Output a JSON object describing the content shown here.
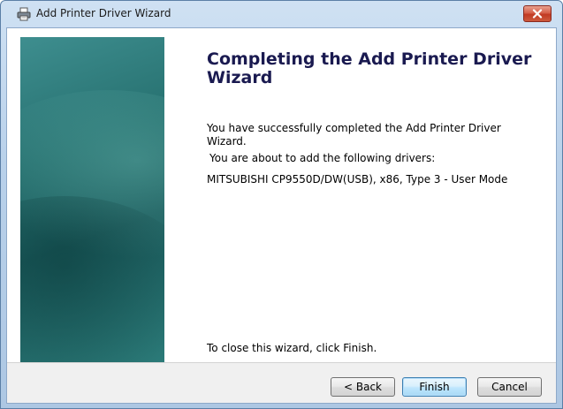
{
  "window": {
    "title": "Add Printer Driver Wizard",
    "icon": "printer-icon",
    "close_icon": "close-icon"
  },
  "wizard": {
    "heading": "Completing the Add Printer Driver Wizard",
    "success_text": "You have successfully completed the Add Printer Driver Wizard.",
    "about_text": "You are about to add the following drivers:",
    "driver_text": "MITSUBISHI CP9550D/DW(USB), x86, Type 3 - User Mode",
    "close_hint": "To close this wizard, click Finish."
  },
  "buttons": {
    "back": "< Back",
    "finish": "Finish",
    "cancel": "Cancel"
  },
  "colors": {
    "banner": "#26706f",
    "heading": "#1a1a50",
    "close_button": "#c13a23"
  }
}
